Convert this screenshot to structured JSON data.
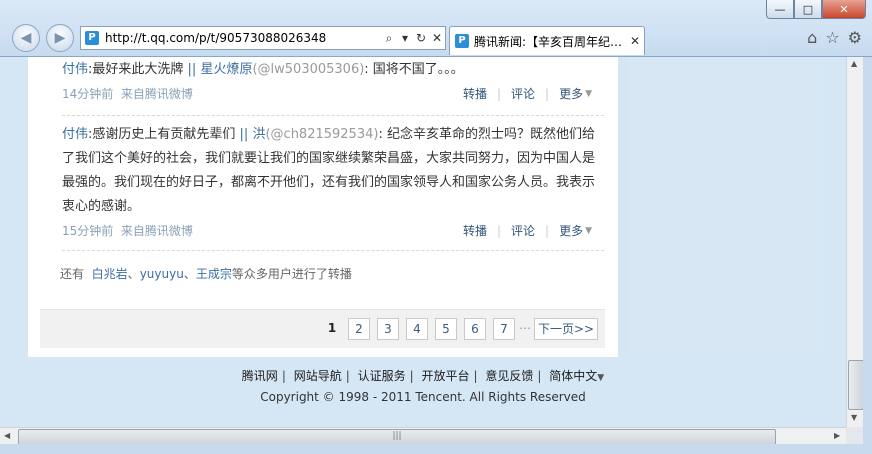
{
  "browser": {
    "url": "http://t.qq.com/p/t/90573088026348",
    "tab_title": "腾讯新闻:【辛亥百周年纪…",
    "fav_letter": "P",
    "window_buttons": {
      "minimize": "—",
      "maximize": "□",
      "close": "✕"
    },
    "addr_controls": {
      "search": "⌕",
      "dropdown": "▾",
      "refresh": "↻",
      "stop": "✕"
    },
    "toolbar": {
      "home": "⌂",
      "favorites": "☆",
      "tools": "⚙"
    }
  },
  "posts": [
    {
      "author": "付伟",
      "colon": ":",
      "text": "最好来此大洗牌",
      "sep": " || ",
      "reply_name": "星火燎原",
      "reply_handle": "(@lw503005306)",
      "reply_text": ": 国将不国了。。。",
      "time": "14分钟前",
      "source": "来自腾讯微博",
      "actions": [
        "转播",
        "评论",
        "更多"
      ]
    },
    {
      "author": "付伟",
      "colon": ":",
      "text": "感谢历史上有贡献先辈们",
      "sep": " || ",
      "reply_name": "洪",
      "reply_handle": "(@ch821592534)",
      "reply_text": ": 纪念辛亥革命的烈士吗？既然他们给了我们这个美好的社会，我们就要让我们的国家继续繁荣昌盛，大家共同努力，因为中国人是最强的。我们现在的好日子，都离不开他们，还有我们的国家领导人和国家公务人员。我表示衷心的感谢。",
      "time": "15分钟前",
      "source": "来自腾讯微博",
      "actions": [
        "转播",
        "评论",
        "更多"
      ]
    }
  ],
  "repost": {
    "prefix": "还有",
    "users": [
      "白兆岩",
      "yuyuyu",
      "王成宗"
    ],
    "suffix": "等众多用户进行了转播",
    "sep": "、"
  },
  "pagination": {
    "pages": [
      "1",
      "2",
      "3",
      "4",
      "5",
      "6",
      "7"
    ],
    "current": "1",
    "ellipsis": "…",
    "next": "下一页>>"
  },
  "footer": {
    "links": [
      "腾讯网",
      "网站导航",
      "认证服务",
      "开放平台",
      "意见反馈",
      "简体中文"
    ],
    "copyright": "Copyright © 1998 - 2011 Tencent. All Rights Reserved"
  }
}
